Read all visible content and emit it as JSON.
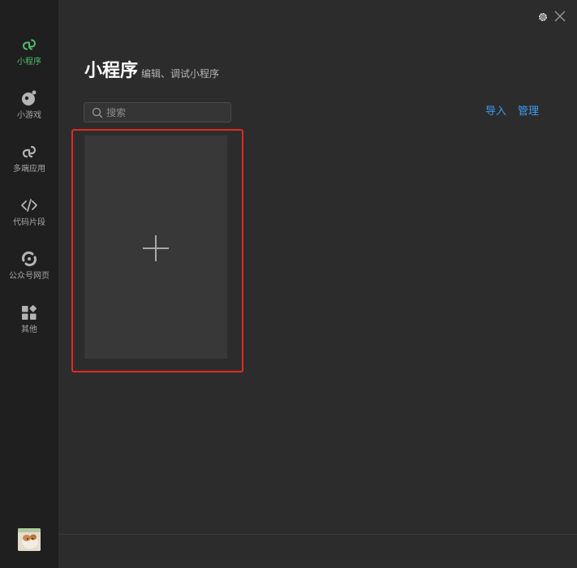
{
  "sidebar": {
    "items": [
      {
        "label": "小程序",
        "icon": "miniprogram-icon",
        "active": true
      },
      {
        "label": "小游戏",
        "icon": "minigame-icon",
        "active": false
      },
      {
        "label": "多端应用",
        "icon": "multiplatform-icon",
        "active": false
      },
      {
        "label": "代码片段",
        "icon": "code-icon",
        "active": false
      },
      {
        "label": "公众号网页",
        "icon": "webpage-icon",
        "active": false
      },
      {
        "label": "其他",
        "icon": "grid-icon",
        "active": false
      }
    ],
    "avatar": "user-avatar"
  },
  "header": {
    "title": "小程序",
    "subtitle": "编辑、调试小程序"
  },
  "search": {
    "placeholder": "搜索"
  },
  "actions": {
    "import_label": "导入",
    "manage_label": "管理"
  },
  "colors": {
    "accent": "#4fbf6a",
    "link": "#3c9cf2",
    "highlight": "#e12a22",
    "sidebar_bg": "#1f1f1f",
    "main_bg": "#2c2c2c"
  }
}
